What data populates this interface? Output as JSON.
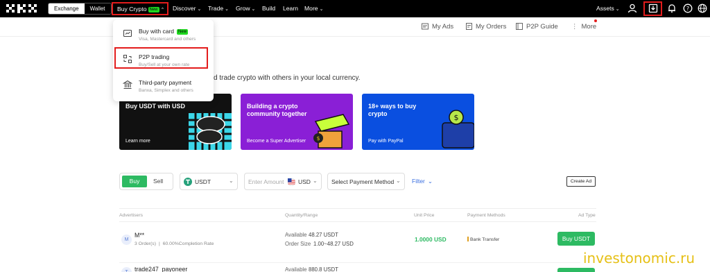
{
  "header": {
    "segment": [
      "Exchange",
      "Wallet"
    ],
    "nav": [
      {
        "label": "Buy Crypto",
        "badge": "New"
      },
      {
        "label": "Discover"
      },
      {
        "label": "Trade"
      },
      {
        "label": "Grow"
      },
      {
        "label": "Build"
      },
      {
        "label": "Learn"
      },
      {
        "label": "More"
      }
    ],
    "assets_label": "Assets"
  },
  "subnav": {
    "my_ads": "My Ads",
    "my_orders": "My Orders",
    "p2p_guide": "P2P Guide",
    "more": "More"
  },
  "dropdown": {
    "items": [
      {
        "title": "Buy with card",
        "badge": "New",
        "subtitle": "Visa, Mastercard and others",
        "icon": "card-icon"
      },
      {
        "title": "P2P trading",
        "subtitle": "Buy/Sell at your own rate",
        "icon": "p2p-icon"
      },
      {
        "title": "Third-party payment",
        "subtitle": "Banxa, Simplex and others",
        "icon": "bank-icon"
      }
    ]
  },
  "tagline": "d trade crypto with others in your local currency.",
  "banners": [
    {
      "title": "Buy USDT with USD",
      "subtitle": "Learn more",
      "color": "#111111"
    },
    {
      "title": "Building a crypto community together",
      "subtitle": "Become a Super Advertiser",
      "color": "#8a1fd6"
    },
    {
      "title": "18+ ways to buy crypto",
      "subtitle": "Pay with PayPal",
      "color": "#0a4fe0"
    }
  ],
  "filters": {
    "buy": "Buy",
    "sell": "Sell",
    "crypto": "USDT",
    "amount_placeholder": "Enter Amount",
    "fiat": "USD",
    "payment": "Select Payment Method",
    "filter": "Filter",
    "create_ad": "Create Ad"
  },
  "table": {
    "headers": [
      "Advertisers",
      "Quantity/Range",
      "Unit Price",
      "Payment Methods",
      "Ad Type"
    ],
    "rows": [
      {
        "avatar": "M",
        "name": "M**",
        "orders": "3 Order(s)",
        "completion": "60.00%Completion Rate",
        "available_label": "Available",
        "available": "48.27 USDT",
        "order_size_label": "Order Size",
        "order_size": "1.00~48.27 USD",
        "price": "1.0000 USD",
        "payment": "Bank Transfer",
        "action": "Buy USDT"
      },
      {
        "avatar": "T",
        "name": "trade247_payoneer",
        "available_label": "Available",
        "available": "880.8 USDT"
      }
    ]
  },
  "watermark": "investonomic.ru",
  "colors": {
    "accent_green": "#2dba62",
    "highlight_red": "#e31c1c",
    "link_blue": "#3b6fe0"
  }
}
